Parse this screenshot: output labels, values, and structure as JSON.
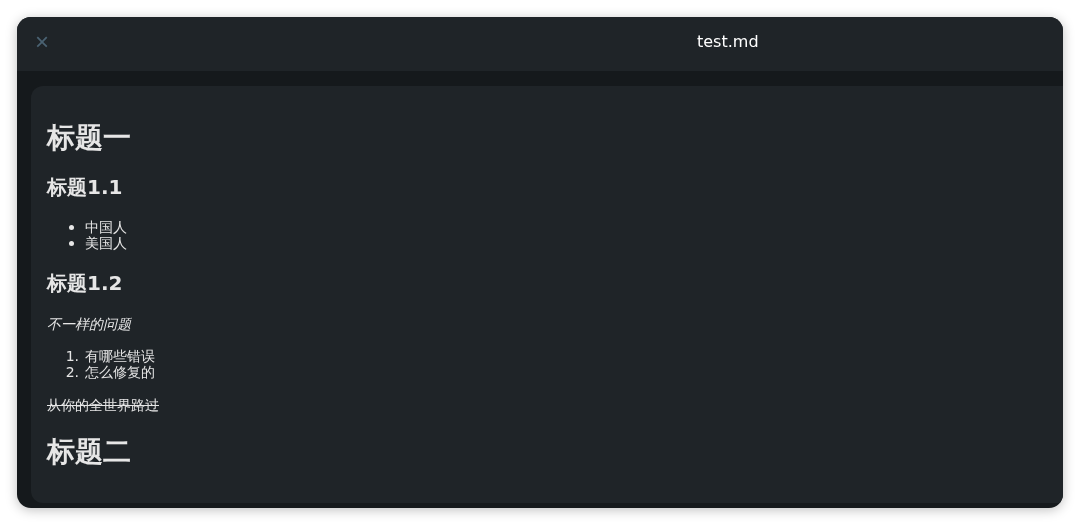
{
  "window": {
    "title": "test.md",
    "close_icon": "×"
  },
  "document": [
    {
      "kind": "h1",
      "text": "标题一"
    },
    {
      "kind": "h2",
      "text": "标题1.1"
    },
    {
      "kind": "ul",
      "items": [
        "中国人",
        "美国人"
      ]
    },
    {
      "kind": "h2",
      "text": "标题1.2"
    },
    {
      "kind": "em",
      "text": "不一样的问题"
    },
    {
      "kind": "ol",
      "items": [
        {
          "marker": "1.",
          "text": "有哪些错误"
        },
        {
          "marker": "2.",
          "text": "怎么修复的"
        }
      ]
    },
    {
      "kind": "del",
      "text": "从你的全世界路过"
    },
    {
      "kind": "h1",
      "text": "标题二"
    }
  ]
}
